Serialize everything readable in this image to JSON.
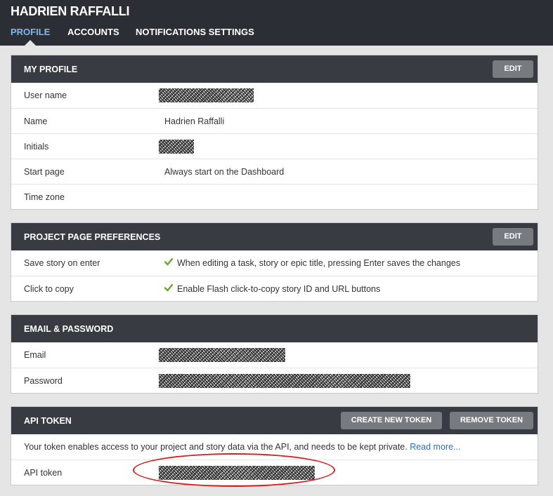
{
  "header": {
    "title": "HADRIEN RAFFALLI",
    "tabs": [
      "PROFILE",
      "ACCOUNTS",
      "NOTIFICATIONS SETTINGS"
    ],
    "active_tab": "PROFILE"
  },
  "my_profile": {
    "title": "MY PROFILE",
    "edit_label": "EDIT",
    "rows": [
      {
        "label": "User name",
        "value": ""
      },
      {
        "label": "Name",
        "value": "Hadrien Raffalli"
      },
      {
        "label": "Initials",
        "value": ""
      },
      {
        "label": "Start page",
        "value": "Always start on the Dashboard"
      },
      {
        "label": "Time zone",
        "value": ""
      }
    ]
  },
  "project_prefs": {
    "title": "PROJECT PAGE PREFERENCES",
    "edit_label": "EDIT",
    "rows": [
      {
        "label": "Save story on enter",
        "value": "When editing a task, story or epic title, pressing Enter saves the changes",
        "checked": true
      },
      {
        "label": "Click to copy",
        "value": "Enable Flash click-to-copy story ID and URL buttons",
        "checked": true
      }
    ]
  },
  "email_password": {
    "title": "EMAIL & PASSWORD",
    "rows": [
      {
        "label": "Email",
        "value": ""
      },
      {
        "label": "Password",
        "value": ""
      }
    ]
  },
  "api_token": {
    "title": "API TOKEN",
    "create_label": "CREATE NEW TOKEN",
    "remove_label": "REMOVE TOKEN",
    "info_text": "Your token enables access to your project and story data via the API, and needs to be kept private.",
    "read_more": "Read more...",
    "rows": [
      {
        "label": "API token",
        "value": ""
      }
    ]
  },
  "colors": {
    "header_bg": "#2c2e36",
    "panel_head_bg": "#393b43",
    "button_bg": "#777b80",
    "active_tab": "#7fb7f0",
    "check_green": "#6aa62e",
    "link": "#2a6db8",
    "annotation_red": "#d61f1f"
  }
}
